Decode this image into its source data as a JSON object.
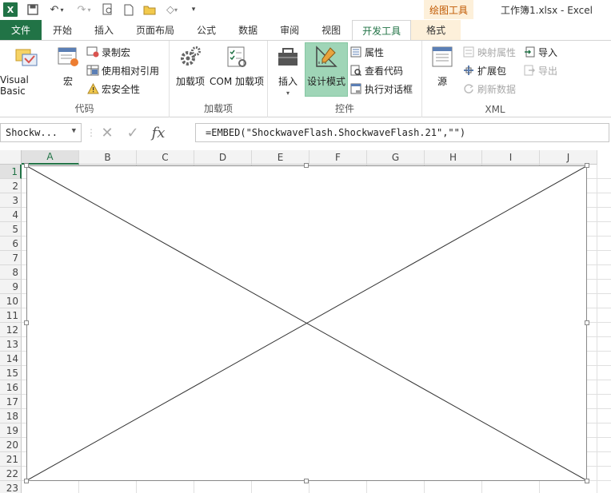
{
  "window": {
    "title": "工作簿1.xlsx - Excel",
    "context_tool_title": "绘图工具",
    "accent_color": "#217346",
    "context_color": "#ed9a2e"
  },
  "tabs": [
    {
      "label": "文件"
    },
    {
      "label": "开始"
    },
    {
      "label": "插入"
    },
    {
      "label": "页面布局"
    },
    {
      "label": "公式"
    },
    {
      "label": "数据"
    },
    {
      "label": "审阅"
    },
    {
      "label": "视图"
    },
    {
      "label": "开发工具",
      "active": true
    },
    {
      "label": "格式"
    }
  ],
  "ribbon": {
    "code": {
      "label": "代码",
      "visual_basic": "Visual Basic",
      "macros": "宏",
      "record_macro": "录制宏",
      "relative_refs": "使用相对引用",
      "macro_security": "宏安全性"
    },
    "addins": {
      "label": "加载项",
      "addins": "加载项",
      "com_addins": "COM 加载项"
    },
    "controls": {
      "label": "控件",
      "insert": "插入",
      "design_mode": "设计模式",
      "properties": "属性",
      "view_code": "查看代码",
      "run_dialog": "执行对话框"
    },
    "xml": {
      "label": "XML",
      "source": "源",
      "map_properties": "映射属性",
      "expansion_packs": "扩展包",
      "refresh_data": "刷新数据",
      "import": "导入",
      "export": "导出"
    }
  },
  "formula_bar": {
    "name_box": "Shockw...",
    "formula": "=EMBED(\"ShockwaveFlash.ShockwaveFlash.21\",\"\")"
  },
  "sheet": {
    "columns": [
      "A",
      "B",
      "C",
      "D",
      "E",
      "F",
      "G",
      "H",
      "I",
      "J"
    ],
    "rows": [
      "1",
      "2",
      "3",
      "4",
      "5",
      "6",
      "7",
      "8",
      "9",
      "10",
      "11",
      "12",
      "13",
      "14",
      "15",
      "16",
      "17",
      "18",
      "19",
      "20",
      "21",
      "22",
      "23"
    ]
  }
}
